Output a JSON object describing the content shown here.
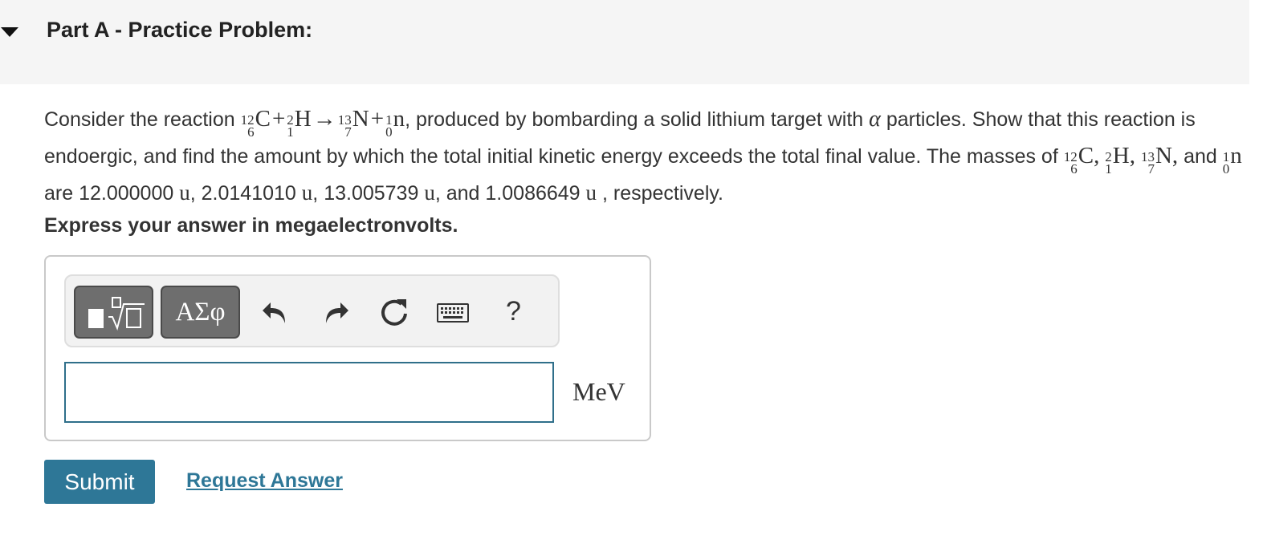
{
  "part": {
    "title": "Part A - Practice Problem:"
  },
  "question": {
    "text_1": "Consider the reaction",
    "reaction": {
      "c12": {
        "mass": "12",
        "atomic": "6",
        "symbol": "C"
      },
      "plus_1": "+",
      "h2": {
        "mass": "2",
        "atomic": "1",
        "symbol": "H"
      },
      "arrow": "→",
      "n13": {
        "mass": "13",
        "atomic": "7",
        "symbol": "N"
      },
      "plus_2": "+",
      "neutron": {
        "mass": "1",
        "atomic": "0",
        "symbol": "n"
      }
    },
    "text_2": ", produced by bombarding a solid lithium target with",
    "alpha": "α",
    "text_3": "particles. Show that this reaction is endoergic, and find the amount by which the total initial kinetic energy exceeds the total final value. The masses of",
    "comma": ",",
    "and": "and",
    "text_4": "are",
    "masses": [
      {
        "value": "12.000000",
        "unit": "u"
      },
      {
        "value": "2.0141010",
        "unit": "u"
      },
      {
        "value": "13.005739",
        "unit": "u"
      },
      {
        "value": "1.0086649",
        "unit": "u"
      }
    ],
    "text_end": ", respectively."
  },
  "instruction": "Express your answer in megaelectronvolts.",
  "toolbar": {
    "symbols_label": "ΑΣφ",
    "help_label": "?",
    "icons": [
      "templates-icon",
      "undo-icon",
      "redo-icon",
      "reset-icon",
      "keyboard-icon"
    ]
  },
  "answer": {
    "value": "",
    "unit": "MeV"
  },
  "actions": {
    "submit_label": "Submit",
    "request_label": "Request Answer"
  },
  "colors": {
    "header_bg": "#f5f5f5",
    "accent": "#2e7797",
    "input_border": "#2f6f8a"
  }
}
